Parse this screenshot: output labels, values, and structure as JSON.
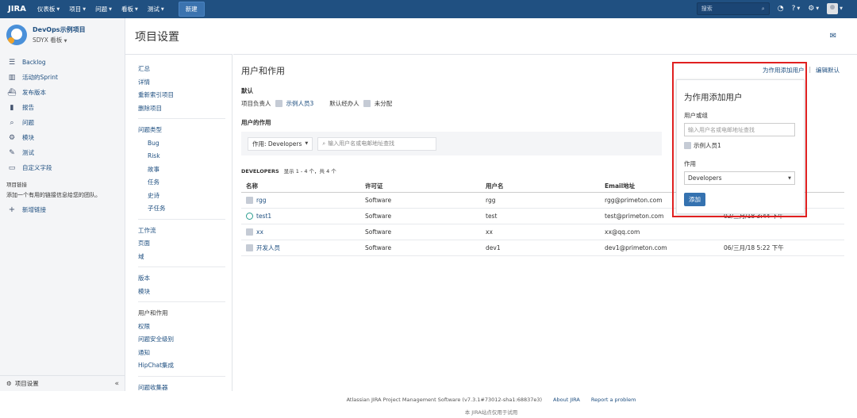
{
  "nav": {
    "logo": "JIRA",
    "menu": [
      "仪表板",
      "项目",
      "问题",
      "看板",
      "测试"
    ],
    "create": "新建",
    "search_placeholder": "搜索"
  },
  "sidebar": {
    "project_name": "DevOps示例项目",
    "board": "SDYX 看板",
    "items": [
      {
        "label": "Backlog",
        "icon": "backlog-icon",
        "glyph": "☰"
      },
      {
        "label": "活动的Sprint",
        "icon": "sprint-board-icon",
        "glyph": "▥"
      },
      {
        "label": "发布版本",
        "icon": "ship-icon",
        "glyph": "⛴"
      },
      {
        "label": "报告",
        "icon": "reports-icon",
        "glyph": "▮"
      },
      {
        "label": "问题",
        "icon": "issues-icon",
        "glyph": "⌕"
      },
      {
        "label": "模块",
        "icon": "components-icon",
        "glyph": "⚙"
      },
      {
        "label": "测试",
        "icon": "test-icon",
        "glyph": "✎"
      },
      {
        "label": "自定义字段",
        "icon": "custom-field-icon",
        "glyph": "▭"
      }
    ],
    "links_heading": "项目链接",
    "links_desc": "添加一个有用的链接信息给您的团队。",
    "add_link": "新增链接",
    "footer_label": "项目设置",
    "collapse": "«"
  },
  "page": {
    "title": "项目设置"
  },
  "settings_nav": {
    "group1": [
      "汇总",
      "详情",
      "重新索引项目",
      "删除项目"
    ],
    "issue_types": "问题类型",
    "issue_sub": [
      "Bug",
      "Risk",
      "故事",
      "任务",
      "史诗",
      "子任务"
    ],
    "group3": [
      "工作流",
      "页面",
      "域"
    ],
    "group4": [
      "版本",
      "模块"
    ],
    "group5": [
      "用户和作用",
      "权限",
      "问题安全级别",
      "通知",
      "HipChat集成"
    ],
    "group6": [
      "问题收集器"
    ]
  },
  "main": {
    "section_title": "用户和作用",
    "add_user_link": "为作用添加用户",
    "edit_defaults_link": "编辑默认",
    "defaults_heading": "默认",
    "project_lead_label": "项目负责人",
    "project_lead": "示例人员3",
    "default_assignee_label": "默认经办人",
    "default_assignee": "未分配",
    "roles_heading": "用户的作用",
    "role_filter": "作用: Developers",
    "filter_placeholder": "输入用户名或电邮地址查找",
    "group_name": "DEVELOPERS",
    "count_text": "显示 1 - 4 个，共 4 个",
    "columns": [
      "名称",
      "许可证",
      "用户名",
      "Email地址",
      ""
    ],
    "rows": [
      {
        "name": "rgg",
        "license": "Software",
        "username": "rgg",
        "email": "rgg@primeton.com",
        "last": "",
        "avatar": "grey"
      },
      {
        "name": "test1",
        "license": "Software",
        "username": "test",
        "email": "test@primeton.com",
        "last": "02/三月/18 3:44 下午",
        "avatar": "green"
      },
      {
        "name": "xx",
        "license": "Software",
        "username": "xx",
        "email": "xx@qq.com",
        "last": "",
        "avatar": "grey"
      },
      {
        "name": "开发人员",
        "license": "Software",
        "username": "dev1",
        "email": "dev1@primeton.com",
        "last": "06/三月/18 5:22 下午",
        "avatar": "grey"
      }
    ]
  },
  "panel": {
    "title": "为作用添加用户",
    "user_label": "用户或组",
    "user_placeholder": "输入用户名或电邮地址查找",
    "suggested": "示例人员1",
    "role_label": "作用",
    "role_value": "Developers",
    "add_button": "添加"
  },
  "footer": {
    "product": "Atlassian JIRA Project Management Software (v7.3.1#73012-sha1:68837e3)",
    "about": "About JIRA",
    "report": "Report a problem",
    "sub": "本 JIRA站点仅用于试用"
  },
  "colors": {
    "nav": "#205081",
    "link": "#205081",
    "highlight": "#e02020"
  }
}
